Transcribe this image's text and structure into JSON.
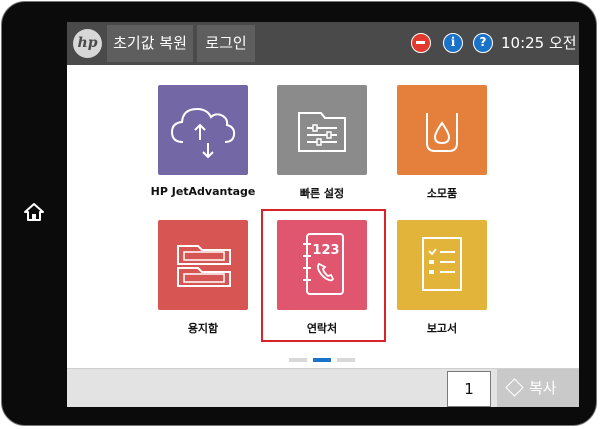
{
  "header": {
    "reset_label": "초기값 복원",
    "login_label": "로그인",
    "time": "10:25 오전",
    "logo_text": "hp",
    "info_glyph": "i",
    "help_glyph": "?"
  },
  "apps": [
    {
      "label": "HP JetAdvantage",
      "icon": "cloud-sync-icon",
      "color": "#7467a5"
    },
    {
      "label": "빠른 설정",
      "icon": "settings-folder-icon",
      "color": "#8b8b8b"
    },
    {
      "label": "소모품",
      "icon": "ink-drop-icon",
      "color": "#e57f3c"
    },
    {
      "label": "용지함",
      "icon": "paper-tray-icon",
      "color": "#d75552"
    },
    {
      "label": "연락처",
      "icon": "contacts-book-icon",
      "color": "#e0566f",
      "number": "123"
    },
    {
      "label": "보고서",
      "icon": "report-list-icon",
      "color": "#e2b53a"
    }
  ],
  "pager": {
    "page_count": 3,
    "current_page": 2
  },
  "footer": {
    "copies": "1",
    "copy_label": "복사"
  },
  "colors": {
    "topbar": "#4a4a4a",
    "highlight": "#d9232a",
    "accent": "#1a73c9"
  }
}
